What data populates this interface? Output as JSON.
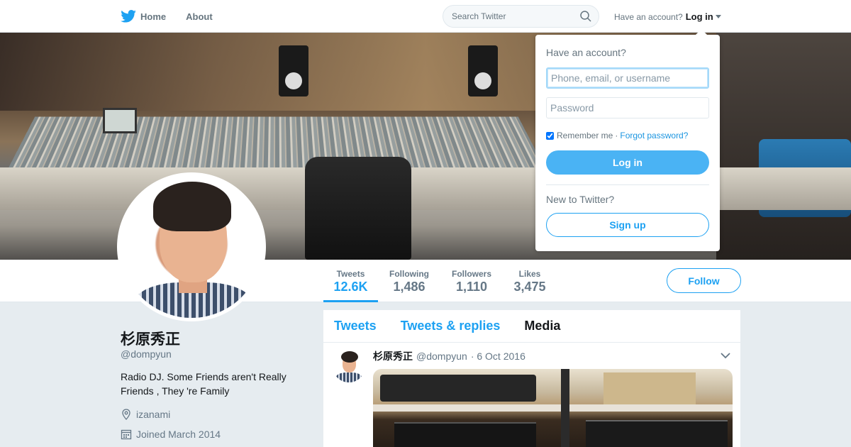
{
  "nav": {
    "home_label": "Home",
    "about_label": "About",
    "search_placeholder": "Search Twitter",
    "account_prompt": "Have an account?",
    "login_label": "Log in"
  },
  "profile_nav": {
    "stats": [
      {
        "label": "Tweets",
        "value": "12.6K"
      },
      {
        "label": "Following",
        "value": "1,486"
      },
      {
        "label": "Followers",
        "value": "1,110"
      },
      {
        "label": "Likes",
        "value": "3,475"
      }
    ],
    "follow_label": "Follow"
  },
  "profile": {
    "name": "杉原秀正",
    "handle": "@dompyun",
    "bio": "Radio DJ. Some Friends aren't Really Friends , They 're Family",
    "location": "izanami",
    "joined": "Joined March 2014"
  },
  "timeline": {
    "tabs": [
      "Tweets",
      "Tweets & replies",
      "Media"
    ],
    "tweet": {
      "name": "杉原秀正",
      "handle": "@dompyun",
      "date": "· 6 Oct 2016"
    }
  },
  "login_dropdown": {
    "title": "Have an account?",
    "username_placeholder": "Phone, email, or username",
    "password_placeholder": "Password",
    "remember_label": "Remember me",
    "separator": "·",
    "forgot_label": "Forgot password?",
    "login_button": "Log in",
    "new_prompt": "New to Twitter?",
    "signup_button": "Sign up"
  },
  "colors": {
    "brand_blue": "#1da1f2",
    "login_button": "#4ab3f4",
    "page_bg": "#e6ecf0"
  }
}
